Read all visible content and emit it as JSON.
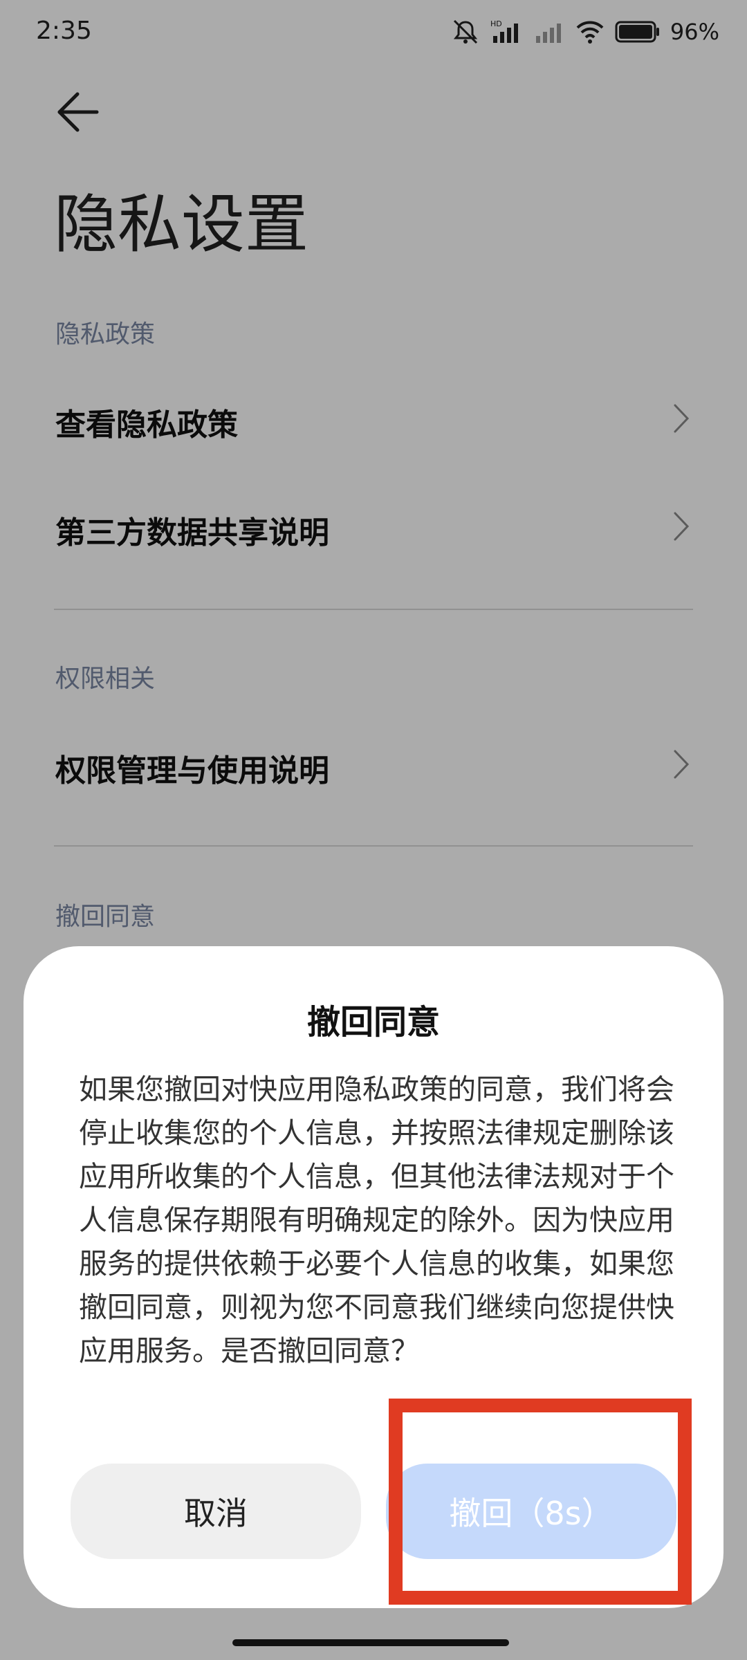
{
  "status_bar": {
    "time": "2:35",
    "battery_percent": "96%",
    "icons": [
      "mute-icon",
      "hd-signal-icon",
      "signal-icon",
      "wifi-icon",
      "battery-icon"
    ]
  },
  "header": {
    "title": "隐私设置"
  },
  "sections": [
    {
      "label": "隐私政策",
      "items": [
        "查看隐私政策",
        "第三方数据共享说明"
      ]
    },
    {
      "label": "权限相关",
      "items": [
        "权限管理与使用说明"
      ]
    },
    {
      "label": "撤回同意",
      "items": []
    }
  ],
  "dialog": {
    "title": "撤回同意",
    "body": "如果您撤回对快应用隐私政策的同意，我们将会停止收集您的个人信息，并按照法律规定删除该应用所收集的个人信息，但其他法律法规对于个人信息保存期限有明确规定的除外。因为快应用服务的提供依赖于必要个人信息的收集，如果您撤回同意，则视为您不同意我们继续向您提供快应用服务。是否撤回同意？",
    "cancel_label": "取消",
    "confirm_label": "撤回（8s）"
  },
  "colors": {
    "accent_disabled": "#c5d9fb",
    "highlight": "#e03b22",
    "section_label": "#7a86a3"
  }
}
